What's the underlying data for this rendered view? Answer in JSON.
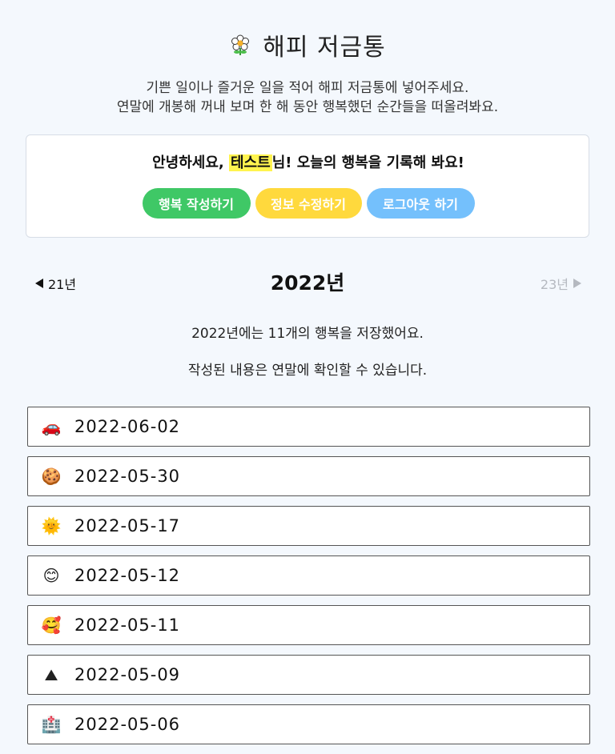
{
  "app": {
    "title": "해피 저금통",
    "logo_icon": "flower-icon"
  },
  "description": {
    "line1": "기쁜 일이나 즐거운 일을 적어 해피 저금통에 넣어주세요.",
    "line2": "연말에 개봉해 꺼내 보며 한 해 동안 행복했던 순간들을 떠올려봐요."
  },
  "greeting": {
    "prefix": "안녕하세요, ",
    "username": "테스트",
    "suffix": "님! 오늘의 행복을 기록해 봐요!"
  },
  "buttons": {
    "write": "행복 작성하기",
    "edit": "정보 수정하기",
    "logout": "로그아웃 하기"
  },
  "colors": {
    "green": "#3fc866",
    "yellow": "#ffd93d",
    "blue": "#74c0fc",
    "highlight": "#fff44f"
  },
  "year_nav": {
    "prev_label": "21년",
    "current": "2022년",
    "next_label": "23년"
  },
  "summary": {
    "line1": "2022년에는 11개의 행복을 저장했어요.",
    "line2": "작성된 내용은 연말에 확인할 수 있습니다."
  },
  "entries": [
    {
      "icon": "car-icon",
      "emoji": "🚗",
      "date": "2022-06-02"
    },
    {
      "icon": "cookie-icon",
      "emoji": "🍪",
      "date": "2022-05-30"
    },
    {
      "icon": "sun-icon",
      "emoji": "🌞",
      "date": "2022-05-17"
    },
    {
      "icon": "smile-icon",
      "emoji": "😊",
      "date": "2022-05-12"
    },
    {
      "icon": "heart-face-icon",
      "emoji": "🥰",
      "date": "2022-05-11"
    },
    {
      "icon": "mountain-icon",
      "emoji": "⛰",
      "date": "2022-05-09"
    },
    {
      "icon": "building-icon",
      "emoji": "🏥",
      "date": "2022-05-06"
    }
  ]
}
